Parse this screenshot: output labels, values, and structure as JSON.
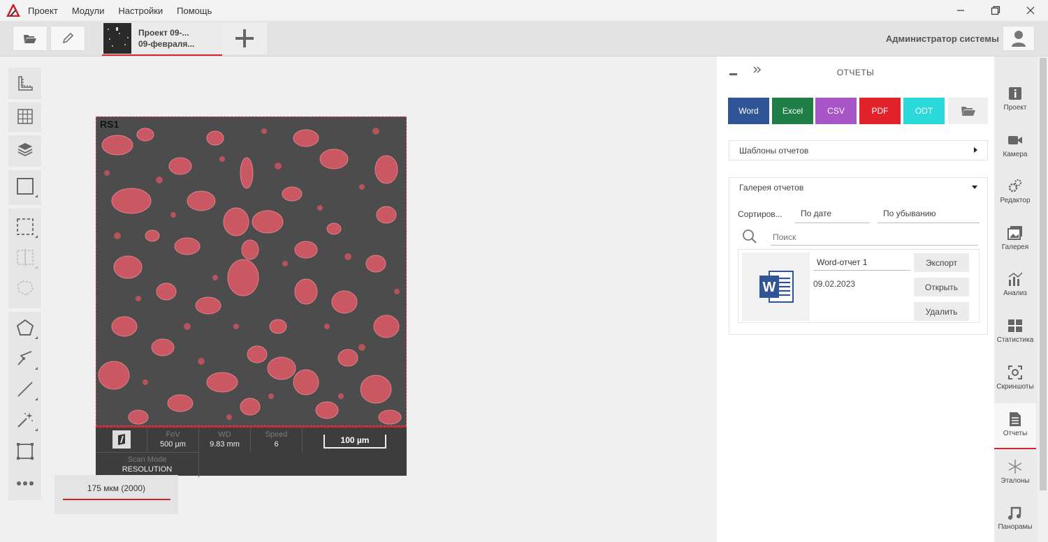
{
  "menubar": {
    "items": [
      "Проект",
      "Модули",
      "Настройки",
      "Помощь"
    ]
  },
  "toolbar": {
    "project_tab": {
      "line1": "Проект 09-...",
      "line2": "09-февраля..."
    },
    "user_name": "Администратор системы"
  },
  "viewer": {
    "label": "RS1",
    "info": {
      "fov_label": "FoV",
      "fov_value": "500 µm",
      "wd_label": "WD",
      "wd_value": "9.83 mm",
      "speed_label": "Speed",
      "speed_value": "6",
      "scale": "100 µm",
      "scan_mode_label": "Scan Mode",
      "scan_mode_value": "RESOLUTION"
    },
    "magnification": "175 мкм (2000)"
  },
  "reports_panel": {
    "title": "ОТЧЕТЫ",
    "export_buttons": [
      {
        "label": "Word",
        "color": "#2f5597"
      },
      {
        "label": "Excel",
        "color": "#1e7e45"
      },
      {
        "label": "CSV",
        "color": "#a855c8"
      },
      {
        "label": "PDF",
        "color": "#e3232c"
      },
      {
        "label": "ODT",
        "color": "#2ad9d9"
      }
    ],
    "templates_title": "Шаблоны отчетов",
    "gallery_title": "Галерея отчетов",
    "sort_label": "Сортиров...",
    "sort_by": "По дате",
    "sort_order": "По убыванию",
    "search_placeholder": "Поиск",
    "report": {
      "name": "Word-отчет 1",
      "date": "09.02.2023",
      "export_label": "Экспорт",
      "open_label": "Открыть",
      "delete_label": "Удалить"
    }
  },
  "rightnav": {
    "items": [
      {
        "label": "Проект",
        "icon": "info-icon"
      },
      {
        "label": "Камера",
        "icon": "camera-icon"
      },
      {
        "label": "Редактор",
        "icon": "gears-icon"
      },
      {
        "label": "Галерея",
        "icon": "gallery-icon"
      },
      {
        "label": "Анализ",
        "icon": "analysis-icon"
      },
      {
        "label": "Статистика",
        "icon": "table-icon"
      },
      {
        "label": "Скриншоты",
        "icon": "screenshot-icon"
      },
      {
        "label": "Отчеты",
        "icon": "document-icon"
      },
      {
        "label": "Эталоны",
        "icon": "asterisk-icon"
      },
      {
        "label": "Панорамы",
        "icon": "panorama-icon"
      }
    ]
  }
}
